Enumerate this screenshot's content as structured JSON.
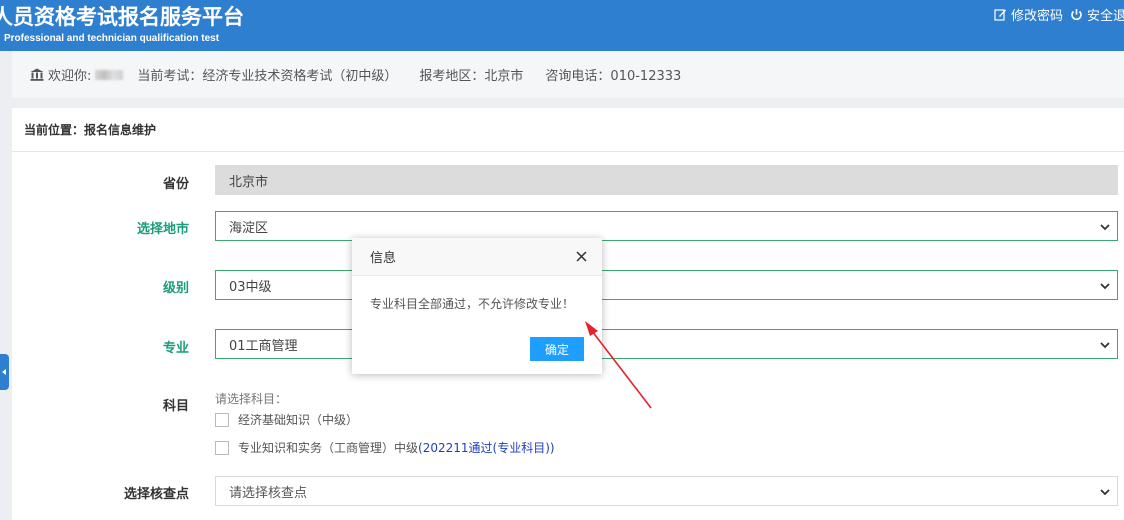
{
  "header": {
    "title": "人员资格考试报名服务平台",
    "subtitle": "Professional and technician qualification test",
    "change_password": "修改密码",
    "logout": "安全退"
  },
  "info_bar": {
    "welcome": "欢迎你:",
    "current_exam": "当前考试：经济专业技术资格考试（初中级）",
    "region": "报考地区：北京市",
    "phone": "咨询电话：010-12333"
  },
  "breadcrumb": "当前位置：报名信息维护",
  "form": {
    "province_label": "省份",
    "province_value": "北京市",
    "city_label": "选择地市",
    "city_value": "海淀区",
    "level_label": "级别",
    "level_value": "03中级",
    "major_label": "专业",
    "major_value": "01工商管理",
    "subject_label": "科目",
    "subject_hint": "请选择科目：",
    "subjects": [
      {
        "label": "经济基础知识（中级）",
        "status": ""
      },
      {
        "label": "专业知识和实务（工商管理）中级",
        "status": "(202211通过(专业科目))"
      }
    ],
    "checkpoint_label": "选择核查点",
    "checkpoint_placeholder": "请选择核查点"
  },
  "dialog": {
    "title": "信息",
    "message": "专业科目全部通过，不允许修改专业！",
    "confirm": "确定"
  },
  "colors": {
    "header_bg": "#2f7fd1",
    "label_green": "#1a9d7c",
    "confirm_blue": "#1e9fff",
    "annotation_arrow": "#e8202a"
  }
}
